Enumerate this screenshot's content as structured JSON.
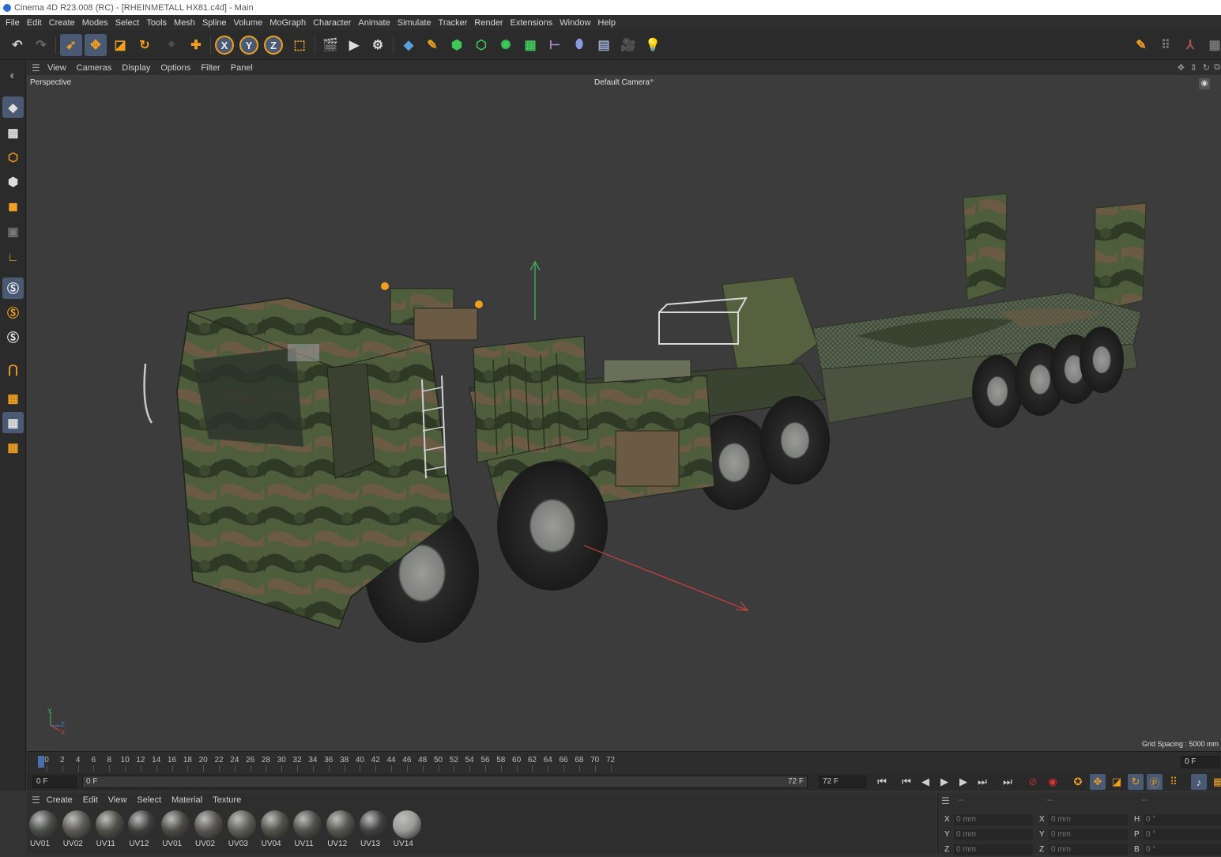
{
  "window": {
    "title": "Cinema 4D R23.008 (RC) - [RHEINMETALL HX81.c4d] - Main"
  },
  "menu": [
    "File",
    "Edit",
    "Create",
    "Modes",
    "Select",
    "Tools",
    "Mesh",
    "Spline",
    "Volume",
    "MoGraph",
    "Character",
    "Animate",
    "Simulate",
    "Tracker",
    "Render",
    "Extensions",
    "Window",
    "Help"
  ],
  "viewport_menu": [
    "View",
    "Cameras",
    "Display",
    "Options",
    "Filter",
    "Panel"
  ],
  "viewport": {
    "projection": "Perspective",
    "camera": "Default Camera",
    "grid_spacing": "Grid Spacing : 5000 mm",
    "axis": {
      "x": "X",
      "y": "Y",
      "z": "Z"
    }
  },
  "timeline": {
    "ticks": [
      "0",
      "2",
      "4",
      "6",
      "8",
      "10",
      "12",
      "14",
      "16",
      "18",
      "20",
      "22",
      "24",
      "26",
      "28",
      "30",
      "32",
      "34",
      "36",
      "38",
      "40",
      "42",
      "44",
      "46",
      "48",
      "50",
      "52",
      "54",
      "56",
      "58",
      "60",
      "62",
      "64",
      "66",
      "68",
      "70",
      "72"
    ],
    "current_frame_readout": "0 F"
  },
  "playback": {
    "start_frame": "0 F",
    "slider_start": "0 F",
    "slider_end": "72 F",
    "end_frame": "72 F"
  },
  "materials_menu": [
    "Create",
    "Edit",
    "View",
    "Select",
    "Material",
    "Texture"
  ],
  "materials": [
    {
      "name": "UV01",
      "color": "#4a4c48"
    },
    {
      "name": "UV02",
      "color": "#5b5a55"
    },
    {
      "name": "UV11",
      "color": "#505048"
    },
    {
      "name": "UV12",
      "color": "#3d3e3c"
    },
    {
      "name": "UV01",
      "color": "#4b4a44"
    },
    {
      "name": "UV02",
      "color": "#575650"
    },
    {
      "name": "UV03",
      "color": "#5f5f58"
    },
    {
      "name": "UV04",
      "color": "#515149"
    },
    {
      "name": "UV11",
      "color": "#4e4f4a"
    },
    {
      "name": "UV12",
      "color": "#55554f"
    },
    {
      "name": "UV13",
      "color": "#3e3f3e"
    },
    {
      "name": "UV14",
      "color": "#9a9a98"
    }
  ],
  "coordinates": {
    "header": [
      "--",
      "--",
      "--"
    ],
    "rows": [
      {
        "a": "X",
        "av": "0 mm",
        "b": "X",
        "bv": "0 mm",
        "c": "H",
        "cv": "0 °"
      },
      {
        "a": "Y",
        "av": "0 mm",
        "b": "Y",
        "bv": "0 mm",
        "c": "P",
        "cv": "0 °"
      },
      {
        "a": "Z",
        "av": "0 mm",
        "b": "Z",
        "bv": "0 mm",
        "c": "B",
        "cv": "0 °"
      }
    ]
  },
  "colors": {
    "accent_blue": "#4a5a74",
    "viewport_bg": "#3c3c3c",
    "axis_x": "#d04040",
    "axis_y": "#3fbf5f",
    "axis_z": "#4a7fd6",
    "icon_orange": "#f0a020",
    "icon_green": "#3fc85a",
    "icon_blue": "#58a0e0"
  }
}
